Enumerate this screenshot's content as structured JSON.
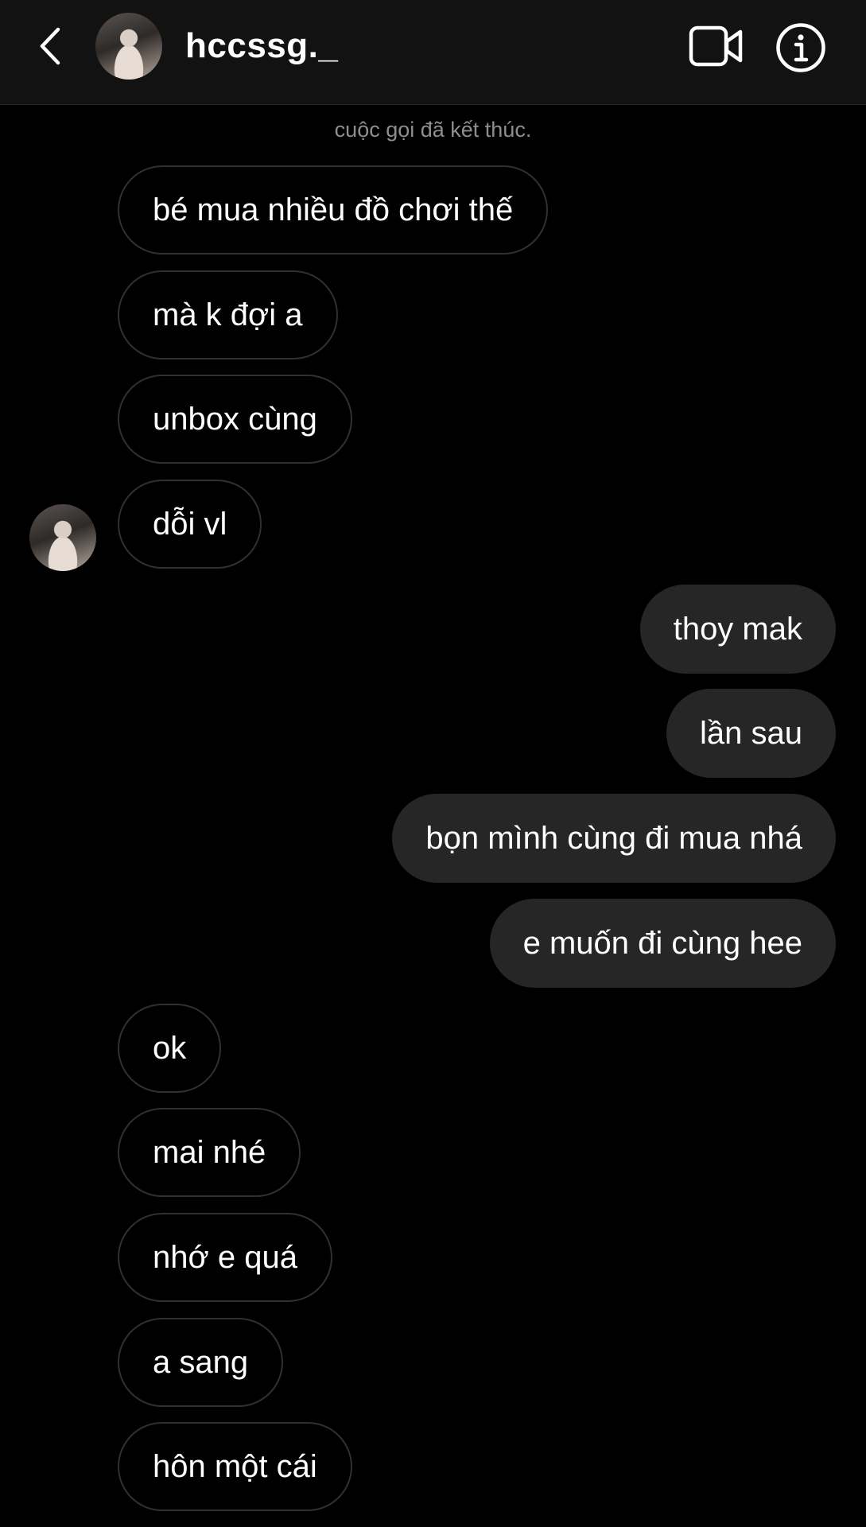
{
  "header": {
    "username": "hccssg._",
    "back_icon": "chevron-left-icon",
    "video_icon": "video-camera-icon",
    "info_icon": "info-icon"
  },
  "system_message": "cuộc gọi đã kết thúc.",
  "messages": [
    {
      "direction": "in",
      "text": "bé mua nhiều đồ chơi thế"
    },
    {
      "direction": "in",
      "text": "mà k đợi a"
    },
    {
      "direction": "in",
      "text": "unbox cùng"
    },
    {
      "direction": "in",
      "text": "dỗi vl"
    },
    {
      "direction": "out",
      "text": "thoy mak"
    },
    {
      "direction": "out",
      "text": "lần sau"
    },
    {
      "direction": "out",
      "text": "bọn mình cùng đi mua nhá"
    },
    {
      "direction": "out",
      "text": "e muốn đi cùng hee"
    },
    {
      "direction": "in",
      "text": "ok"
    },
    {
      "direction": "in",
      "text": "mai nhé"
    },
    {
      "direction": "in",
      "text": "nhớ e quá"
    },
    {
      "direction": "in",
      "text": "a sang"
    },
    {
      "direction": "in",
      "text": "hôn một cái"
    }
  ],
  "colors": {
    "background": "#000000",
    "header_bg": "#121212",
    "outgoing_bubble": "#262626",
    "incoming_border": "#303030",
    "muted_text": "#8e8e8e"
  }
}
